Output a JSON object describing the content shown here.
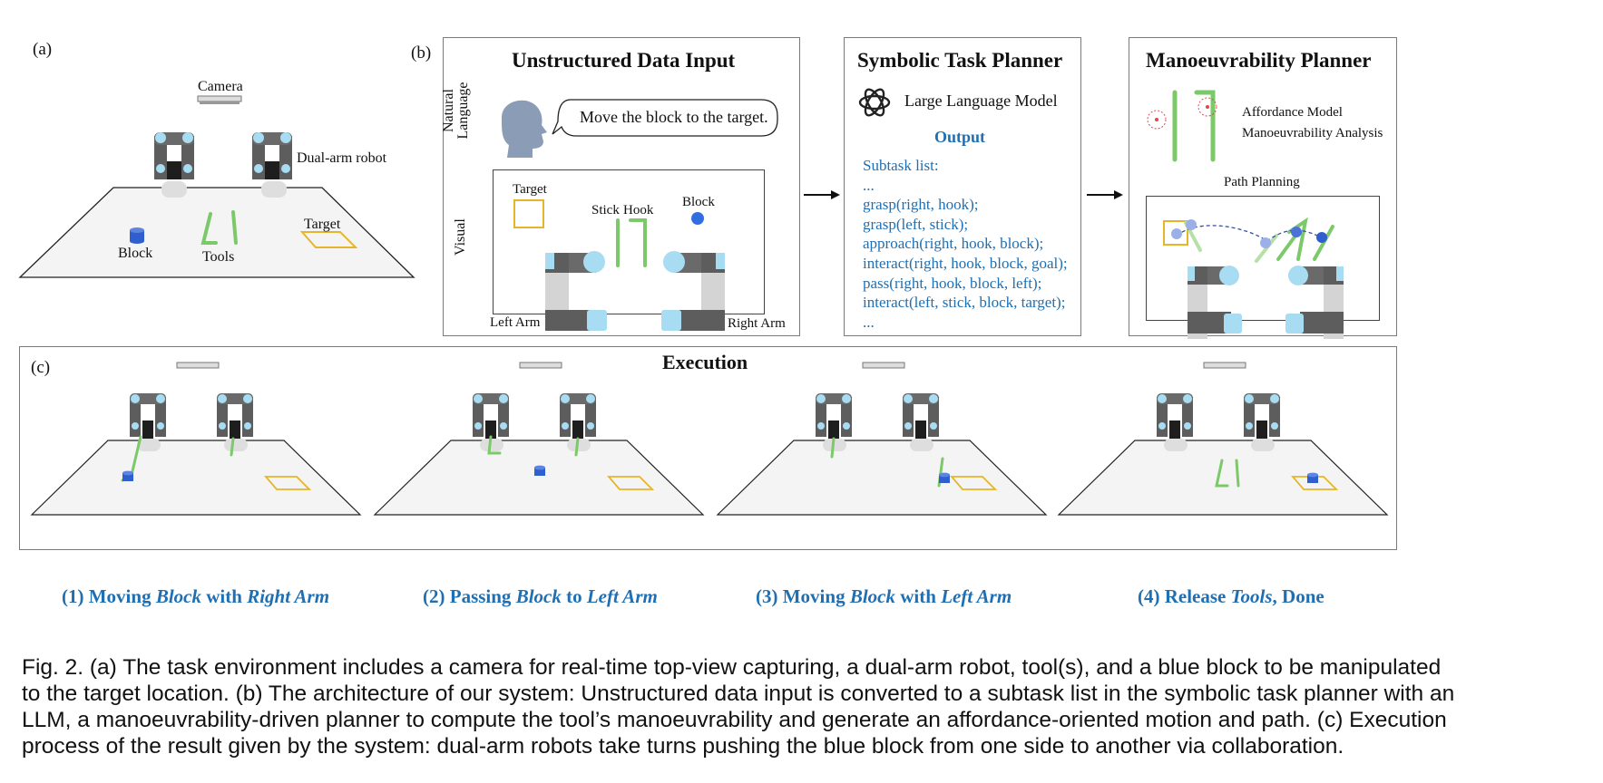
{
  "panel_a": {
    "tag": "(a)",
    "camera_label": "Camera",
    "robot_label": "Dual-arm robot",
    "target_label": "Target",
    "block_label": "Block",
    "tools_label": "Tools"
  },
  "panel_b": {
    "tag": "(b)",
    "input": {
      "title": "Unstructured Data Input",
      "natural_language_label": "Natural Language",
      "speech": "Move the block to the target.",
      "visual_label": "Visual",
      "target_label": "Target",
      "stick_label": "Stick",
      "hook_label": "Hook",
      "block_label": "Block",
      "left_arm_label": "Left Arm",
      "right_arm_label": "Right Arm"
    },
    "symbolic": {
      "title": "Symbolic Task Planner",
      "llm_label": "Large Language Model",
      "output_heading": "Output",
      "subtask_lines": [
        "Subtask list:",
        "...",
        "grasp(right, hook);",
        "grasp(left, stick);",
        "approach(right, hook, block);",
        "interact(right, hook, block, goal);",
        "pass(right, hook, block, left);",
        "interact(left, stick, block, target);",
        "..."
      ]
    },
    "manoeuvrability": {
      "title": "Manoeuvrability Planner",
      "affordance_label": "Affordance Model",
      "analysis_label": "Manoeuvrability Analysis",
      "path_label": "Path Planning"
    }
  },
  "panel_c": {
    "tag": "(c)",
    "title": "Execution",
    "steps": [
      {
        "prefix": "(1) Moving ",
        "obj": "Block",
        "mid": " with ",
        "arm": "Right Arm",
        "suffix": ""
      },
      {
        "prefix": "(2) Passing ",
        "obj": "Block",
        "mid": " to ",
        "arm": "Left Arm",
        "suffix": ""
      },
      {
        "prefix": "(3) Moving ",
        "obj": "Block",
        "mid": " with ",
        "arm": "Left Arm",
        "suffix": ""
      },
      {
        "prefix": "(4) Release ",
        "obj": "Tools",
        "mid": ", Done",
        "arm": "",
        "suffix": ""
      }
    ]
  },
  "caption": {
    "lines": [
      "Fig. 2.  (a) The task environment includes a camera for real-time top-view capturing, a dual-arm robot, tool(s), and a blue block to be manipulated",
      "to the target location. (b) The architecture of our system: Unstructured data input is converted to a subtask list in the symbolic task planner with an",
      "LLM, a manoeuvrability-driven planner to compute the tool’s manoeuvrability and generate an affordance-oriented motion and path. (c) Execution",
      "process of the result given by the system: dual-arm robots take turns pushing the blue block from one side to another via collaboration."
    ]
  },
  "colors": {
    "accent_blue": "#1f6fb2",
    "block_blue": "#2f5fcf",
    "tool_green": "#7cc96a",
    "target_yellow": "#e5b52a",
    "arm_dark": "#5d5d5d",
    "arm_light": "#cfcfcf",
    "joint_cyan": "#a8dcf2"
  },
  "icons": [
    "openai-logo-icon",
    "head-silhouette-icon",
    "camera-icon",
    "arrow-right-icon"
  ]
}
